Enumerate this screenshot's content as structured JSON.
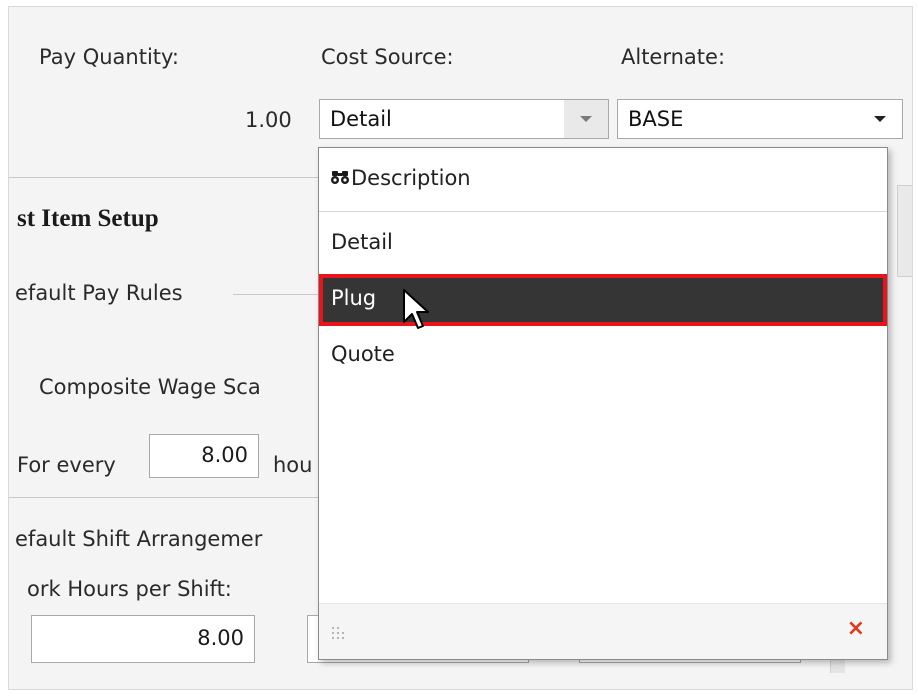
{
  "header": {
    "pay_quantity_label": "Pay Quantity:",
    "cost_source_label": "Cost Source:",
    "alternate_label": "Alternate:",
    "pay_quantity_value": "1.00"
  },
  "cost_source_combo": {
    "value": "Detail"
  },
  "alternate_combo": {
    "value": "BASE"
  },
  "section": {
    "title": "st Item Setup",
    "default_pay_rules": "efault Pay Rules",
    "composite_wage": "Composite Wage Sca",
    "for_every": "For every",
    "for_every_value": "8.00",
    "hours_fragment": "hou",
    "default_shift": "efault Shift Arrangemer",
    "work_hours": "ork Hours per Shift:",
    "work_hours_value": "8.00"
  },
  "dropdown": {
    "header_label": "Description",
    "options": [
      "Detail",
      "Plug",
      "Quote"
    ],
    "selected": "Plug"
  },
  "colors": {
    "selected_bg": "#353535",
    "selected_border": "#e8141c",
    "close_icon": "#e2391a"
  }
}
